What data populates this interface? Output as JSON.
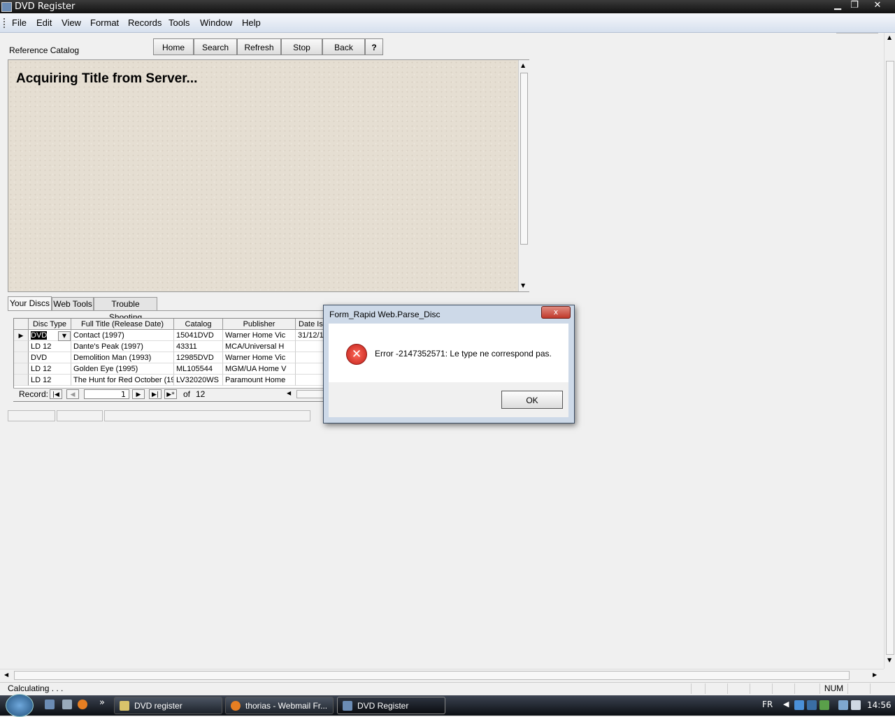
{
  "window": {
    "title": "DVD Register"
  },
  "menu": [
    "File",
    "Edit",
    "View",
    "Format",
    "Records",
    "Tools",
    "Window",
    "Help"
  ],
  "toolbar": {
    "section_label": "Reference Catalog",
    "buttons": [
      "Home",
      "Search",
      "Refresh",
      "Stop",
      "Back"
    ],
    "help_label": "?"
  },
  "browser": {
    "heading": "Acquiring Title from Server..."
  },
  "tabs": [
    "Your Discs",
    "Web Tools",
    "Trouble Shooting"
  ],
  "grid": {
    "columns": [
      "Disc Type",
      "Full Title (Release Date)",
      "Catalog",
      "Publisher",
      "Date Is"
    ],
    "rows": [
      [
        "DVD",
        "Contact (1997)",
        "15041DVD",
        "Warner Home Vic",
        "31/12/1"
      ],
      [
        "LD 12",
        "Dante's Peak (1997)",
        "43311",
        "MCA/Universal H",
        ""
      ],
      [
        "DVD",
        "Demolition Man (1993)",
        "12985DVD",
        "Warner Home Vic",
        ""
      ],
      [
        "LD 12",
        "Golden Eye (1995)",
        "ML105544",
        "MGM/UA Home V",
        ""
      ],
      [
        "LD 12",
        "The Hunt for Red October (19",
        "LV32020WS",
        "Paramount Home",
        ""
      ]
    ]
  },
  "navigator": {
    "label": "Record:",
    "current": "1",
    "of_label": "of",
    "total": "12"
  },
  "dialog": {
    "title": "Form_Rapid Web.Parse_Disc",
    "message": "Error -2147352571: Le type ne correspond pas.",
    "ok_label": "OK",
    "close_label": "x"
  },
  "status": {
    "text": "Calculating . . .",
    "num": "NUM"
  },
  "taskbar": {
    "items": [
      "DVD register",
      "thorias - Webmail Fr...",
      "DVD Register"
    ],
    "lang": "FR",
    "clock": "14:56",
    "more": "»"
  },
  "colors": {
    "taskbar": "#1d222a",
    "error_red": "#c2201a",
    "menubar": "#d6e0ee"
  }
}
